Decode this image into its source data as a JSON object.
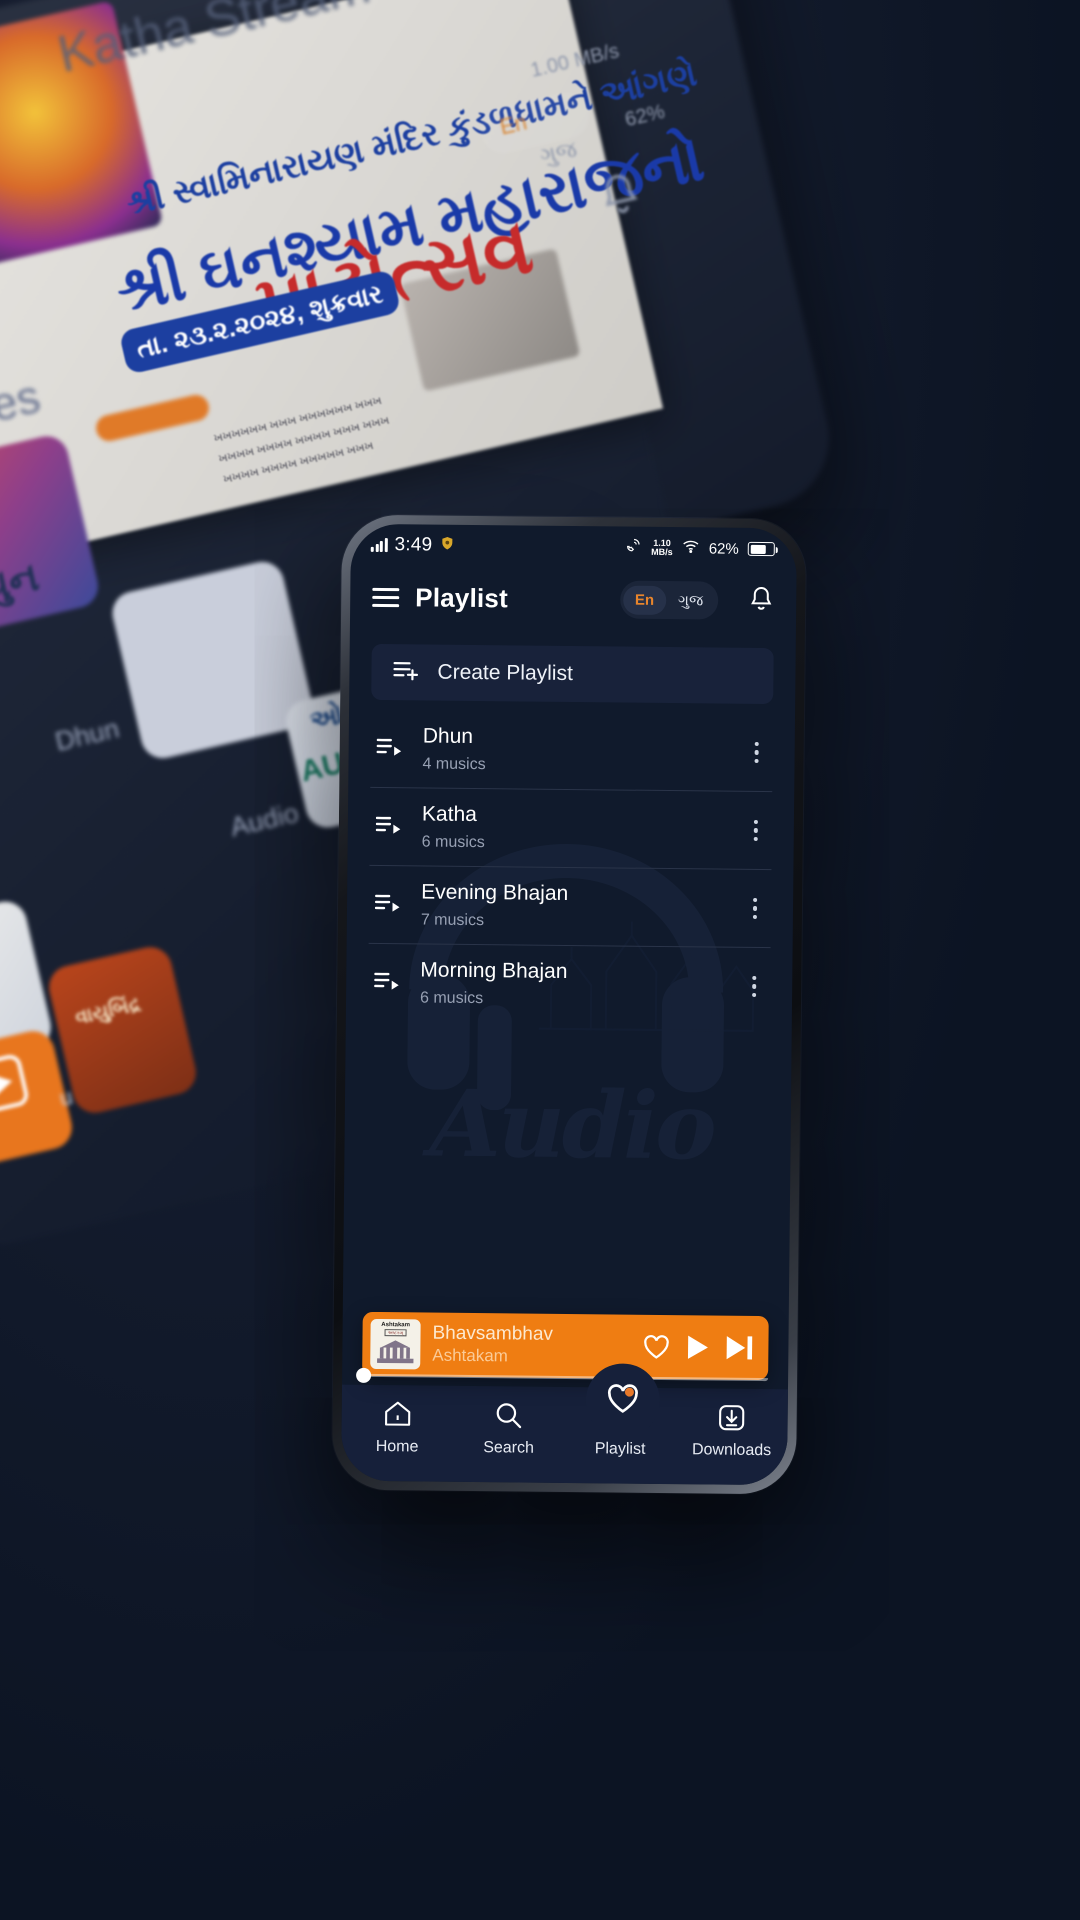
{
  "background": {
    "app_name_faded": "Katha Stream",
    "categories_label": "egories",
    "tile_labels": [
      "Dhun",
      "Audio"
    ],
    "tile_text_gujarati": [
      "ધુન",
      "ઓડિ",
      "AUDIO"
    ],
    "banner_lines": [
      "શ્રી સ્વામિનારાયણ મંદિર કુંડળધામને આંગણે",
      "શ્રી ઘનશ્યામ મહારાજનો",
      "૧૮મો",
      "પાટોત્સવ",
      "તા. ૨૩.૨.૨૦૨૪, શુક્રવાર"
    ],
    "status": {
      "speed": "1.00 MB/s",
      "battery": "62%"
    },
    "lang": {
      "active": "En",
      "inactive": "ગુજ"
    }
  },
  "statusbar": {
    "time": "3:49",
    "network_speed_value": "1.10",
    "network_speed_unit": "MB/s",
    "battery_percent": "62%"
  },
  "header": {
    "title": "Playlist",
    "lang_active": "En",
    "lang_inactive": "ગુજ"
  },
  "create_playlist": {
    "label": "Create Playlist"
  },
  "playlists": [
    {
      "name": "Dhun",
      "count": "4 musics"
    },
    {
      "name": "Katha",
      "count": "6 musics"
    },
    {
      "name": "Evening Bhajan",
      "count": "7 musics"
    },
    {
      "name": "Morning Bhajan",
      "count": "6 musics"
    }
  ],
  "mini_player": {
    "title": "Bhavsambhav",
    "subtitle": "Ashtakam",
    "art_title": "Ashtakam",
    "art_badge": "અષ્ટકમ્",
    "accent_color": "#ef7d12"
  },
  "bottom_nav": [
    {
      "label": "Home",
      "icon": "home-icon"
    },
    {
      "label": "Search",
      "icon": "search-icon"
    },
    {
      "label": "Playlist",
      "icon": "heart-icon"
    },
    {
      "label": "Downloads",
      "icon": "download-icon"
    }
  ],
  "watermark": {
    "text": "Audio"
  }
}
